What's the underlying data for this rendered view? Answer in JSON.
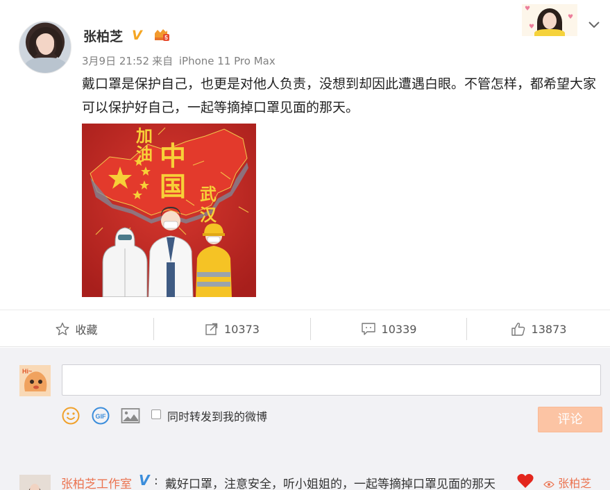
{
  "post": {
    "author": "张柏芝",
    "timestamp": "3月9日 21:52",
    "source_prefix": "来自",
    "source": "iPhone 11 Pro Max",
    "text": "戴口罩是保护自己，也更是对他人负责，没想到却因此遭遇白眼。不管怎样，都希望大家可以保护好自己，一起等摘掉口罩见面的那天。",
    "poster": {
      "word_jiayou": "加油",
      "word_zhongguo": "中国",
      "word_wuhan": "武汉"
    }
  },
  "icons": {
    "verify": "verified-v-icon",
    "vip": "vip-crown-icon",
    "chevron": "chevron-down-icon"
  },
  "actions": {
    "favorite_label": "收藏",
    "repost_count": "10373",
    "comment_count": "10339",
    "like_count": "13873"
  },
  "compose": {
    "forward_label": "同时转发到我的微博",
    "submit_label": "评论",
    "input_value": ""
  },
  "first_comment": {
    "author": "张柏芝工作室",
    "text": "戴好口罩，注意安全，听小姐姐的，一起等摘掉口罩见面的那天",
    "tag": "张柏芝"
  },
  "colors": {
    "accent": "#eb7350",
    "verify_gold": "#f5a623",
    "verify_blue": "#3b8ddb",
    "submit_disabled": "#fcc4a4"
  }
}
